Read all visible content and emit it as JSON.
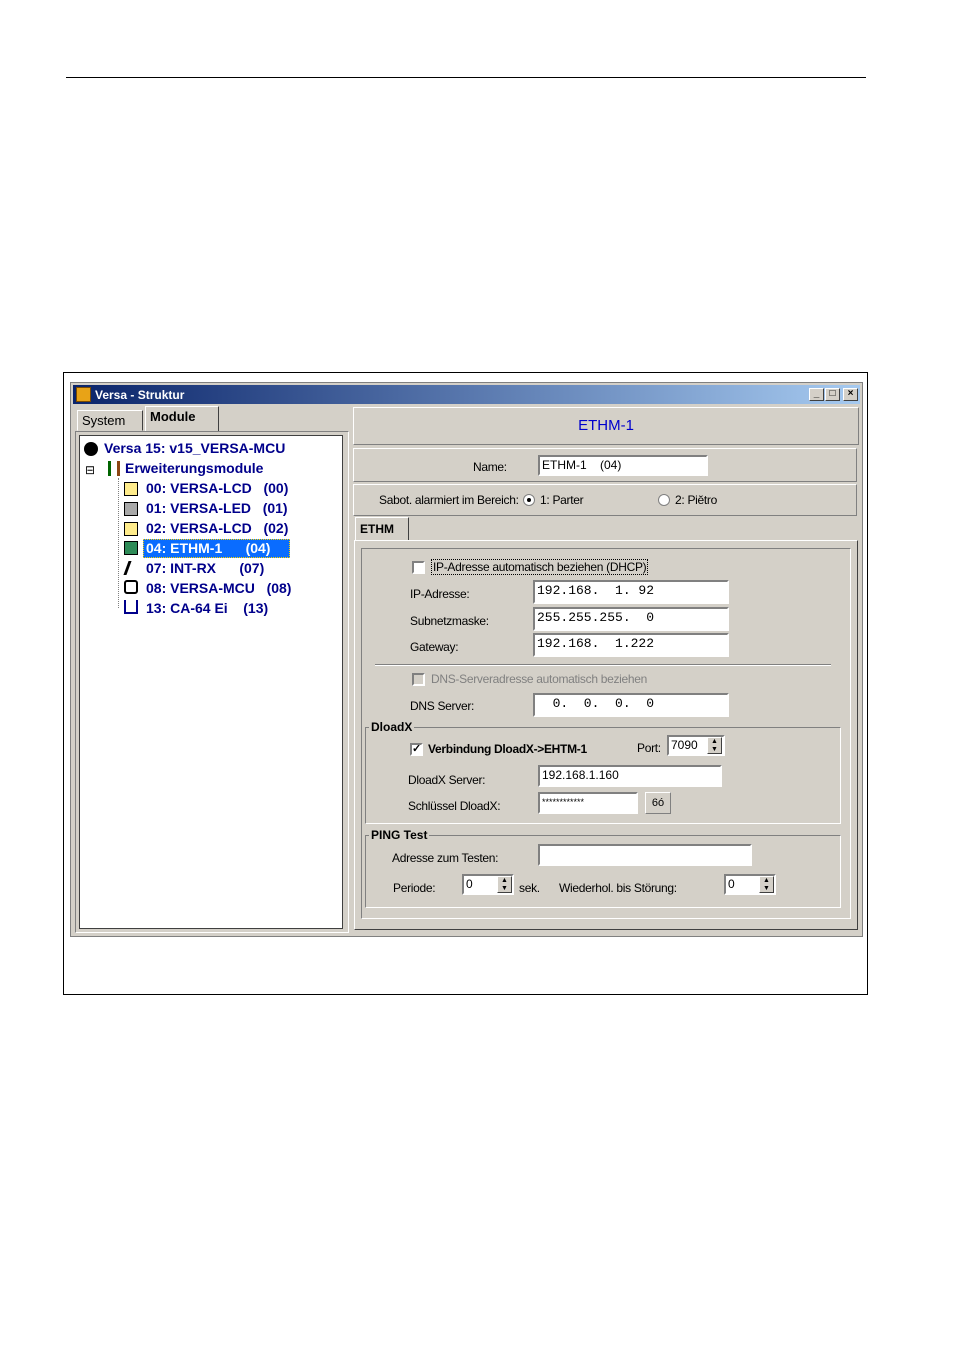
{
  "window": {
    "title": "Versa - Struktur",
    "minimize": "_",
    "maximize": "□",
    "close": "×"
  },
  "left_tabs": [
    "System",
    "Module"
  ],
  "tree": {
    "root": "Versa 15: v15_VERSA-MCU",
    "group": "Erweiterungsmodule",
    "expander": "⊟",
    "items": [
      {
        "label": "00: VERSA-LCD   (00)"
      },
      {
        "label": "01: VERSA-LED   (01)"
      },
      {
        "label": "02: VERSA-LCD   (02)"
      },
      {
        "label": "04: ETHM-1      (04)"
      },
      {
        "label": "07: INT-RX      (07)"
      },
      {
        "label": "08: VERSA-MCU   (08)"
      },
      {
        "label": "13: CA-64 Ei    (13)"
      }
    ]
  },
  "panel": {
    "header": "ETHM-1",
    "name_label": "Name:",
    "name_value": "ETHM-1    (04)",
    "sabot_label": "Sabot. alarmiert im Bereich:",
    "area1": "1: Parter",
    "area2": "2: Piĕtro",
    "tab": "ETHM"
  },
  "ethm": {
    "dhcp_label": "IP-Adresse automatisch beziehen (DHCP)",
    "ip_label": "IP-Adresse:",
    "ip_value": "192.168.  1. 92",
    "mask_label": "Subnetzmaske:",
    "mask_value": "255.255.255.  0",
    "gw_label": "Gateway:",
    "gw_value": "192.168.  1.222",
    "dns_auto_label": "DNS-Serveradresse automatisch beziehen",
    "dns_label": "DNS Server:",
    "dns_value": "  0.  0.  0.  0"
  },
  "dloadx": {
    "title": "DloadX",
    "conn_label": "Verbindung DloadX->EHTM-1",
    "conn_check": "✓",
    "port_label": "Port:",
    "port_value": "7090",
    "server_label": "DloadX Server:",
    "server_value": "192.168.1.160",
    "key_label": "Schlüssel DloadX:",
    "key_value": "************",
    "key_button": "6ó"
  },
  "ping": {
    "title": "PING Test",
    "addr_label": "Adresse zum Testen:",
    "addr_value": "",
    "period_label": "Periode:",
    "period_value": "0",
    "sek": "sek.",
    "repeat_label": "Wiederhol. bis Störung:",
    "repeat_value": "0"
  }
}
